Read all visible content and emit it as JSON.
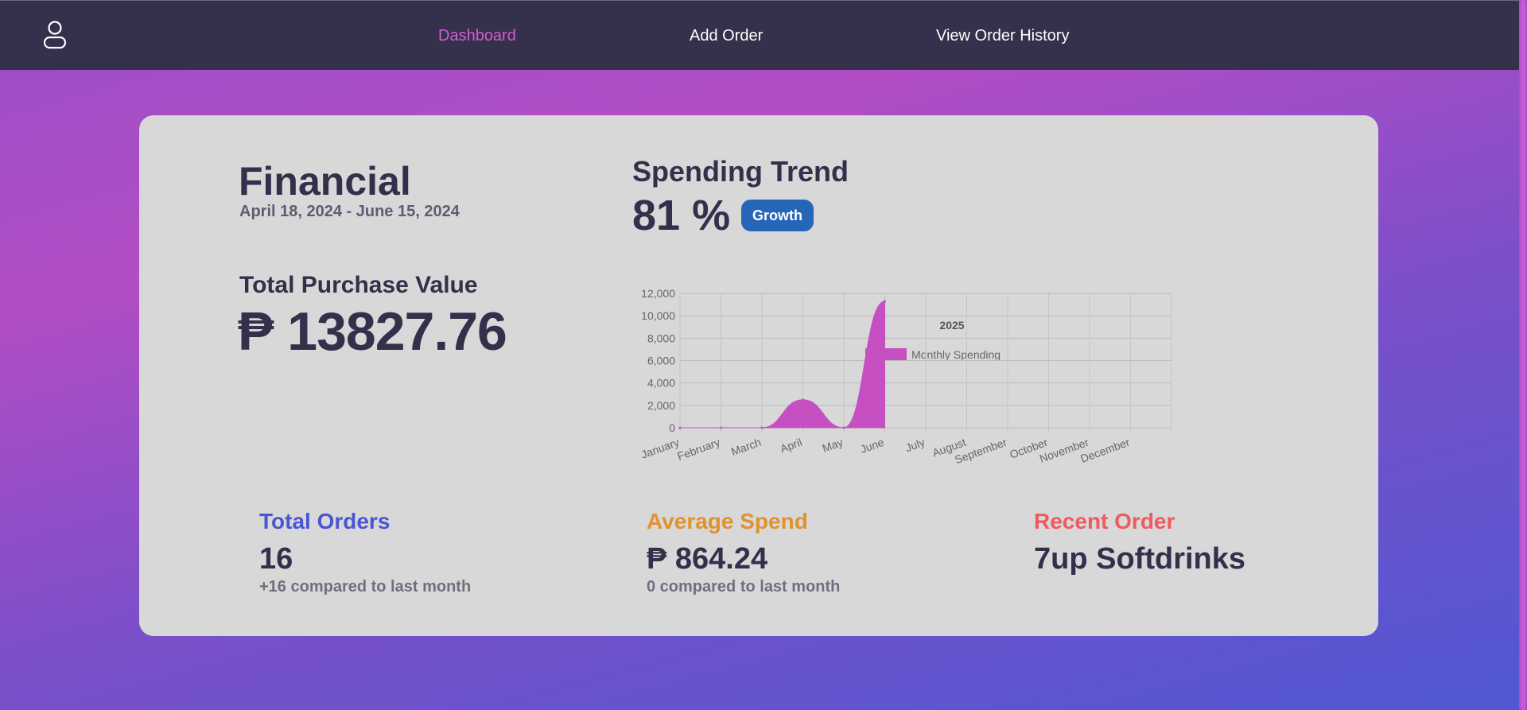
{
  "nav": {
    "links": [
      {
        "label": "Dashboard",
        "active": true
      },
      {
        "label": "Add Order",
        "active": false
      },
      {
        "label": "View Order History",
        "active": false
      }
    ],
    "active_color": "#d65cd0",
    "bar_color": "#35304b"
  },
  "financial": {
    "title": "Financial",
    "date_range": "April 18, 2024 - June 15, 2024",
    "total_label": "Total Purchase Value",
    "total_value": "₱ 13827.76"
  },
  "trend": {
    "title": "Spending Trend",
    "percent": "81 %",
    "badge": "Growth",
    "badge_color": "#2566b8"
  },
  "chart_data": {
    "type": "area",
    "title": "2025",
    "categories": [
      "January",
      "February",
      "March",
      "April",
      "May",
      "June",
      "July",
      "August",
      "September",
      "October",
      "November",
      "December"
    ],
    "series": [
      {
        "name": "Monthly Spending",
        "color": "#c64fc2",
        "values": [
          0,
          0,
          0,
          2500,
          0,
          11300,
          null,
          null,
          null,
          null,
          null,
          null
        ]
      }
    ],
    "ylim": [
      0,
      12000
    ],
    "yticks": [
      0,
      2000,
      4000,
      6000,
      8000,
      10000,
      12000
    ],
    "ytick_labels": [
      "0",
      "2,000",
      "4,000",
      "6,000",
      "8,000",
      "10,000",
      "12,000"
    ],
    "legend": "top-center",
    "grid": true
  },
  "stats": [
    {
      "label": "Total Orders",
      "value": "16",
      "sub": "+16 compared to last month",
      "color": "#4a56d1"
    },
    {
      "label": "Average Spend",
      "value": "₱ 864.24",
      "sub": "0 compared to last month",
      "color": "#e0922e"
    },
    {
      "label": "Recent Order",
      "value": "7up Softdrinks",
      "sub": "",
      "color": "#ef5a5e"
    }
  ]
}
